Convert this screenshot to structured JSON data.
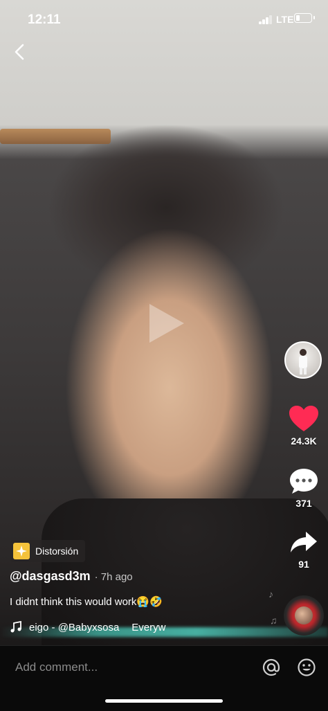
{
  "status_bar": {
    "time": "12:11",
    "network": "LTE",
    "battery_level": 0.25
  },
  "video": {
    "state": "paused"
  },
  "actions": {
    "likes": "24.3K",
    "comments": "371",
    "shares": "91"
  },
  "effect": {
    "label": "Distorsión"
  },
  "post": {
    "username": "@dasgasd3m",
    "time_ago": "· 7h ago",
    "caption": "I didnt think this would work😭🤣"
  },
  "music": {
    "note_icon": "music-note-icon",
    "track_text": "eigo - @Babyxsosa",
    "track_text_2": "Everyw"
  },
  "comment_bar": {
    "placeholder": "Add comment..."
  },
  "colors": {
    "like_red": "#ff2b54",
    "accent_teal": "#5ae6d4"
  }
}
